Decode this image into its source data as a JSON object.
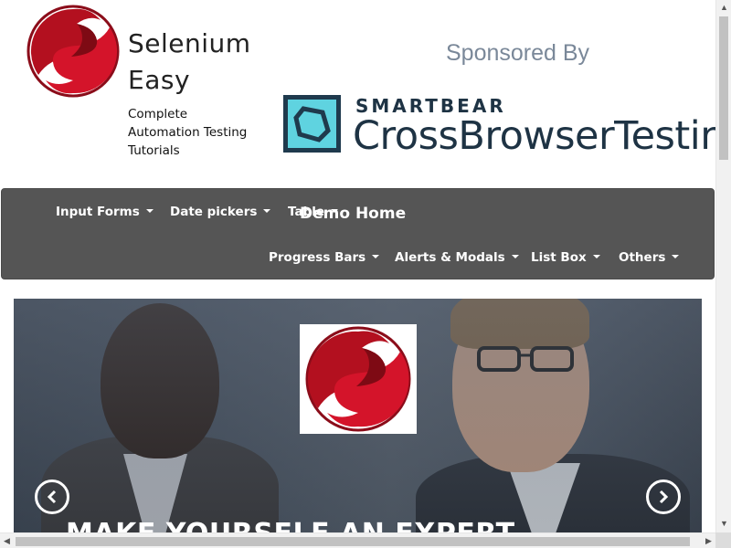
{
  "brand": {
    "name_line1": "Selenium",
    "name_line2": "Easy",
    "tagline_line1": "Complete",
    "tagline_line2": "Automation Testing",
    "tagline_line3": "Tutorials"
  },
  "sponsor": {
    "label": "Sponsored By",
    "company": "SMARTBEAR",
    "product": "CrossBrowserTestin"
  },
  "navbar": {
    "brand": "Demo Home",
    "items": [
      {
        "label": "Input Forms"
      },
      {
        "label": "Date pickers"
      },
      {
        "label": "Table"
      },
      {
        "label": "Progress Bars"
      },
      {
        "label": "Alerts & Modals"
      },
      {
        "label": "List Box"
      },
      {
        "label": "Others"
      }
    ]
  },
  "hero": {
    "caption": "MAKE YOURSELF AN EXPERT"
  },
  "colors": {
    "navbar": "#555555",
    "brand_red": "#c8102e",
    "smartbear_teal": "#5fd3e0",
    "smartbear_dark": "#1e3344"
  }
}
